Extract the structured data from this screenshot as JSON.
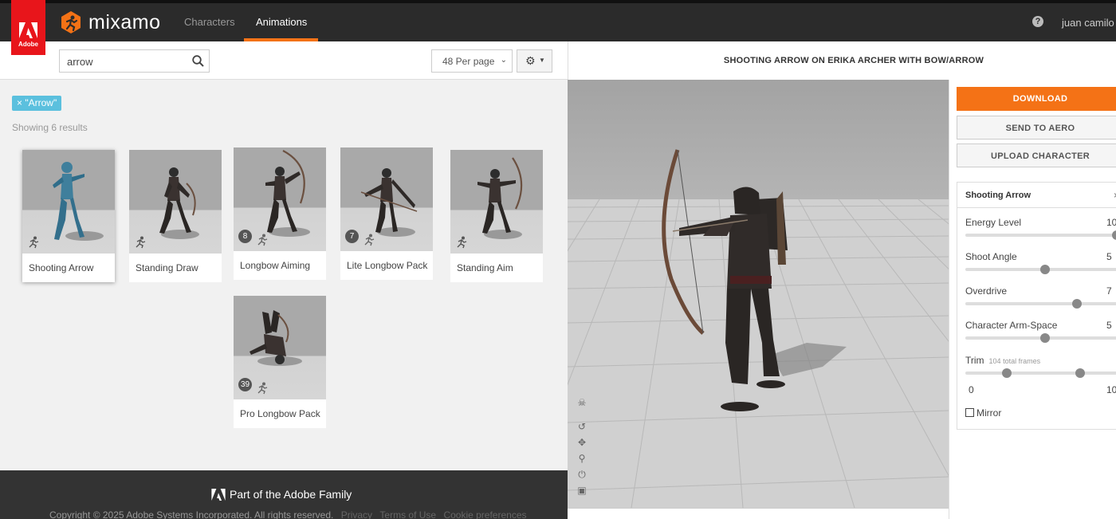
{
  "app": {
    "brand_badge": "Adobe",
    "logo_text": "mixamo",
    "nav": {
      "characters": "Characters",
      "animations": "Animations"
    },
    "help_icon": "?",
    "user_name": "juan camilo t",
    "accent_color": "#f47216"
  },
  "search": {
    "value": "arrow",
    "placeholder": ""
  },
  "per_page": {
    "selected": "48 Per page"
  },
  "filter_tag": "× \"Arrow\"",
  "results_text": "Showing 6 results",
  "cards": [
    {
      "name": "Shooting Arrow",
      "count": "",
      "selected": true
    },
    {
      "name": "Standing Draw",
      "count": ""
    },
    {
      "name": "Longbow Aiming",
      "count": "8"
    },
    {
      "name": "Lite Longbow Pack",
      "count": "7"
    },
    {
      "name": "Standing Aim",
      "count": ""
    },
    {
      "name": "Pro Longbow Pack",
      "count": "39"
    }
  ],
  "footer": {
    "family": "Part of the Adobe Family",
    "copyright": "Copyright © 2025 Adobe Systems Incorporated. All rights reserved.",
    "links": [
      "Privacy",
      "Terms of Use",
      "Cookie preferences"
    ]
  },
  "viewer": {
    "title": "SHOOTING ARROW ON ERIKA ARCHER WITH BOW/ARROW"
  },
  "actions": {
    "download": "DOWNLOAD",
    "send": "SEND TO AERO",
    "upload": "UPLOAD CHARACTER"
  },
  "settings": {
    "title": "Shooting Arrow",
    "close": "×",
    "sliders": [
      {
        "label": "Energy Level",
        "value": "10",
        "fraction": 0.95
      },
      {
        "label": "Shoot Angle",
        "value": "5",
        "fraction": 0.5
      },
      {
        "label": "Overdrive",
        "value": "7",
        "fraction": 0.7
      },
      {
        "label": "Character Arm-Space",
        "value": "5",
        "fraction": 0.5
      }
    ],
    "trim": {
      "label": "Trim",
      "sub": "104 total frames",
      "start_label": "0",
      "end_label": "10",
      "start_fraction": 0.26,
      "end_fraction": 0.72
    },
    "mirror": "Mirror"
  }
}
